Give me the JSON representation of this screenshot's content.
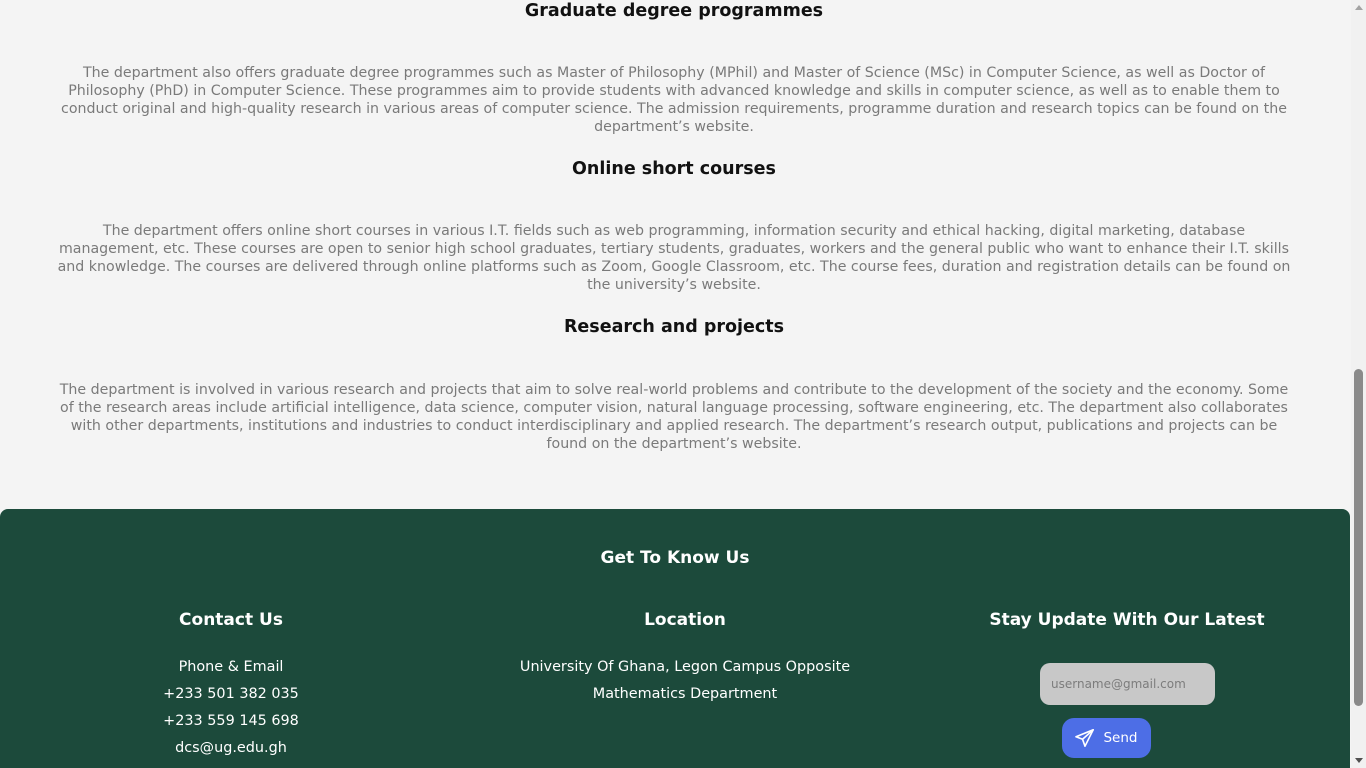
{
  "sections": [
    {
      "title": "Graduate degree programmes",
      "text": "The department also offers graduate degree programmes such as Master of Philosophy (MPhil) and Master of Science (MSc) in Computer Science, as well as Doctor of Philosophy (PhD) in Computer Science. These programmes aim to provide students with advanced knowledge and skills in computer science, as well as to enable them to conduct original and high-quality research in various areas of computer science. The admission requirements, programme duration and research topics can be found on the department’s website."
    },
    {
      "title": "Online short courses",
      "text": "The department offers online short courses in various I.T. fields such as web programming, information security and ethical hacking, digital marketing, database management, etc. These courses are open to senior high school graduates, tertiary students, graduates, workers and the general public who want to enhance their I.T. skills and knowledge. The courses are delivered through online platforms such as Zoom, Google Classroom, etc. The course fees, duration and registration details can be found on the university’s website."
    },
    {
      "title": "Research and projects",
      "text": "The department is involved in various research and projects that aim to solve real-world problems and contribute to the development of the society and the economy. Some of the research areas include artificial intelligence, data science, computer vision, natural language processing, software engineering, etc. The department also collaborates with other departments, institutions and industries to conduct interdisciplinary and applied research. The department’s research output, publications and projects can be found on the department’s website."
    }
  ],
  "footer": {
    "heading": "Get To Know Us",
    "contact": {
      "title": "Contact Us",
      "label": "Phone & Email",
      "phone1": "+233 501 382 035",
      "phone2": "+233 559 145 698",
      "email": "dcs@ug.edu.gh"
    },
    "location": {
      "title": "Location",
      "line1": "University Of Ghana, Legon Campus Opposite",
      "line2": "Mathematics Department"
    },
    "newsletter": {
      "title": "Stay Update With Our Latest",
      "input_value": "",
      "input_placeholder": "username@gmail.com",
      "button_label": "Send",
      "button_icon": "send-icon"
    }
  },
  "colors": {
    "page_background": "#f4f4f4",
    "footer_background": "#1c4a3b",
    "button_background": "#4d6ee6",
    "body_text": "#7a7a7a"
  }
}
